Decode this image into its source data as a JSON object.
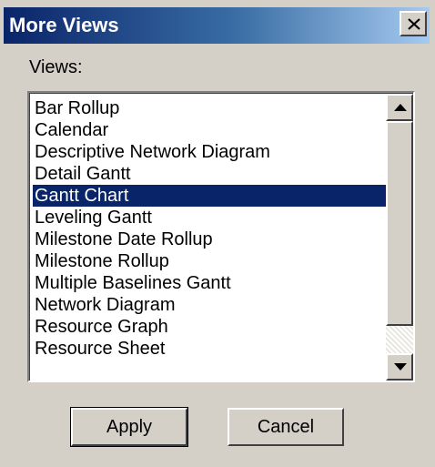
{
  "window": {
    "title": "More Views",
    "close_icon": "close-icon"
  },
  "views_label": "Views:",
  "views": [
    {
      "label": "Bar Rollup",
      "selected": false
    },
    {
      "label": "Calendar",
      "selected": false
    },
    {
      "label": "Descriptive Network Diagram",
      "selected": false
    },
    {
      "label": "Detail Gantt",
      "selected": false
    },
    {
      "label": "Gantt Chart",
      "selected": true
    },
    {
      "label": "Leveling Gantt",
      "selected": false
    },
    {
      "label": "Milestone Date Rollup",
      "selected": false
    },
    {
      "label": "Milestone Rollup",
      "selected": false
    },
    {
      "label": "Multiple Baselines Gantt",
      "selected": false
    },
    {
      "label": "Network Diagram",
      "selected": false
    },
    {
      "label": "Resource Graph",
      "selected": false
    },
    {
      "label": "Resource Sheet",
      "selected": false
    }
  ],
  "buttons": {
    "apply": "Apply",
    "cancel": "Cancel"
  },
  "colors": {
    "selection": "#0a246a",
    "face": "#d4d0c8"
  }
}
